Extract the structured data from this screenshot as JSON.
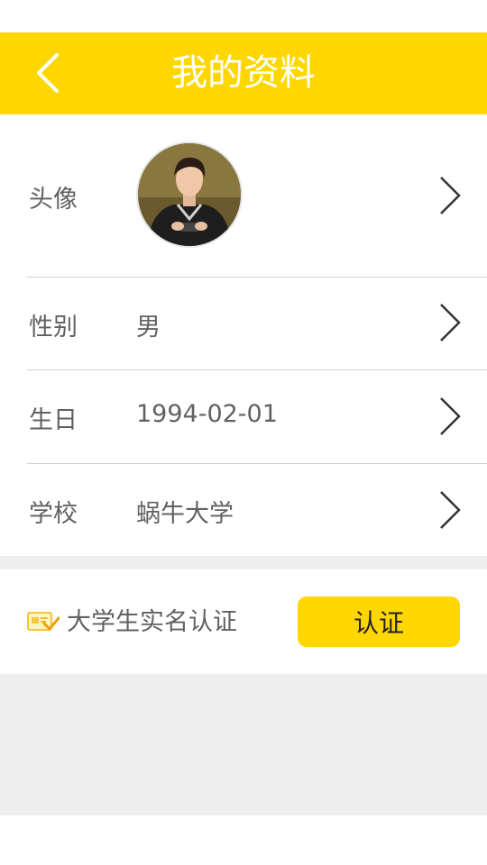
{
  "header": {
    "title": "我的资料",
    "back_icon": "chevron-left-icon",
    "background_color": "#FFD700",
    "title_color": "#FFFFFF"
  },
  "profile": {
    "rows": [
      {
        "label": "头像",
        "value": "",
        "has_avatar": true,
        "chevron_icon": "chevron-right-icon"
      },
      {
        "label": "性别",
        "value": "男",
        "chevron_icon": "chevron-right-icon"
      },
      {
        "label": "生日",
        "value": "1994-02-01",
        "chevron_icon": "chevron-right-icon"
      },
      {
        "label": "学校",
        "value": "蜗牛大学",
        "chevron_icon": "chevron-right-icon"
      }
    ]
  },
  "verification": {
    "icon": "id-card-check-icon",
    "label": "大学生实名认证",
    "button_label": "认证",
    "button_color": "#FFD700"
  },
  "colors": {
    "text_gray": "#616161",
    "section_gap": "#EEEEEE"
  }
}
